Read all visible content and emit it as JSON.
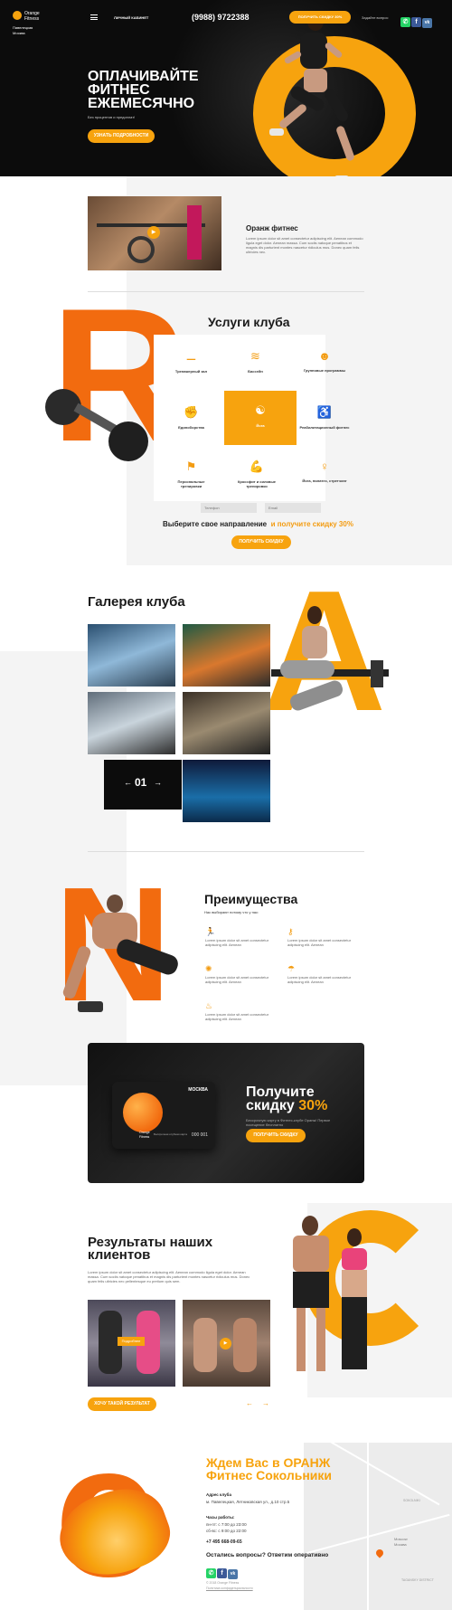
{
  "colors": {
    "accent": "#f7a30e",
    "orange": "#f26b0f",
    "dark": "#0c0c0c"
  },
  "header": {
    "logo_line1": "Orange",
    "logo_line2": "Fitness",
    "city_line1": "Павелецкая",
    "city_line2": "Москва",
    "menu_icon": "hamburger-icon",
    "cabinet": "личный кабинет",
    "phone": "(9988) 9722388",
    "cta": "получить скидку 30%",
    "question": "Задайте вопрос"
  },
  "hero": {
    "title_line1": "ОПЛАЧИВАЙТЕ",
    "title_line2": "ФИТНЕС",
    "title_line3": "ЕЖЕМЕСЯЧНО",
    "subtitle": "Без процентов и предоплат!",
    "button": "Узнать подробности",
    "letter": "O"
  },
  "about": {
    "title": "Оранж фитнес",
    "text": "Lorem ipsum dolor sit amet consectetur adipiscing elit. Aenean commodo ligula eget dolor. Aenean massa. Cum sociis natoque penatibus et magnis dis parturient montes nascetur ridiculus mus. Donec quam felis ultricies nec."
  },
  "services": {
    "title": "Услуги клуба",
    "letter": "R",
    "items": [
      {
        "label": "Тренажерный зал",
        "icon": "barbell-icon"
      },
      {
        "label": "Бассейн",
        "icon": "swimming-icon"
      },
      {
        "label": "Групповые программы",
        "icon": "group-icon"
      },
      {
        "label": "Единоборства",
        "icon": "martial-arts-icon"
      },
      {
        "label": "Йога",
        "icon": "yoga-icon"
      },
      {
        "label": "Реабилитационный фитнес",
        "icon": "rehab-icon"
      },
      {
        "label": "Персональные тренировки",
        "icon": "trainer-icon"
      },
      {
        "label": "Кроссфит и силовые тренировки",
        "icon": "muscle-icon"
      },
      {
        "label": "Йога, пилатес, стретчинг",
        "icon": "stretching-icon"
      }
    ],
    "form": {
      "phone_placeholder": "Телефон",
      "email_placeholder": "Email"
    },
    "promo_text": "Выберите свое направление",
    "promo_accent": "и получите скидку 30%",
    "button": "Получить скидку"
  },
  "gallery": {
    "title": "Галерея клуба",
    "letter": "A",
    "counter": "01",
    "prev": "←",
    "next": "→"
  },
  "advantages": {
    "title": "Преимущества",
    "subtitle": "Нас выбирают потому что у нас:",
    "letter": "N",
    "items": [
      {
        "text": "Lorem ipsum dolor sit amet consectetur adipiscing elit. Aenean",
        "icon": "running-icon"
      },
      {
        "text": "Lorem ipsum dolor sit amet consectetur adipiscing elit. Aenean",
        "icon": "key-icon"
      },
      {
        "text": "Lorem ipsum dolor sit amet consectetur adipiscing elit. Aenean",
        "icon": "sun-icon"
      },
      {
        "text": "Lorem ipsum dolor sit amet consectetur adipiscing elit. Aenean",
        "icon": "shower-icon"
      },
      {
        "text": "Lorem ipsum dolor sit amet consectetur adipiscing elit. Aenean",
        "icon": "sauna-icon"
      }
    ]
  },
  "card_promo": {
    "card_city": "МОСКВА",
    "card_brand_line1": "Orange",
    "card_brand_line2": "Fitness",
    "card_sub": "Бессрочная клубная карта",
    "card_number": "000 001",
    "title_line1": "Получите",
    "title_line2": "скидку",
    "title_accent": "30%",
    "text": "Бессрочную карту в Фитнес-клубе Оранж! Первое посещение бесплатно",
    "button": "Получить скидку"
  },
  "results": {
    "title_line1": "Результаты наших",
    "title_line2": "клиентов",
    "letter": "G",
    "text": "Lorem ipsum dolor sit amet consectetur adipiscing elit. Aenean commodo ligula eget dolor. Aenean massa. Cum sociis natoque penatibus et magnis dis parturient montes nascetur ridiculus mus. Donec quam felis ultricies nec pellentesque eu pretium quis sem.",
    "tag": "Подробнее",
    "button": "Хочу такой результат",
    "prev": "←",
    "next": "→"
  },
  "contacts": {
    "title_line1": "Ждем Вас в ОРАНЖ",
    "title_line2": "Фитнес Сокольники",
    "address_label": "Адрес клуба",
    "address": "м. Павелецкая, Летниковская ул., д.10 стр.5",
    "hours_label": "Часы работы:",
    "hours1": "пн-пт: с 7:00 до 23:00",
    "hours2": "сб-вс: с 9:00 до 22:00",
    "phone": "+7 495 668-09-65",
    "question": "Остались вопросы? Ответим оперативно",
    "copyright": "© 2018 Orange Fitness",
    "policy": "Политика конфиденциальности",
    "letter": "e",
    "map_labels": [
      "SOKOLNIKI",
      "Moscow",
      "Москва",
      "TAGANSKY DISTRICT"
    ]
  }
}
